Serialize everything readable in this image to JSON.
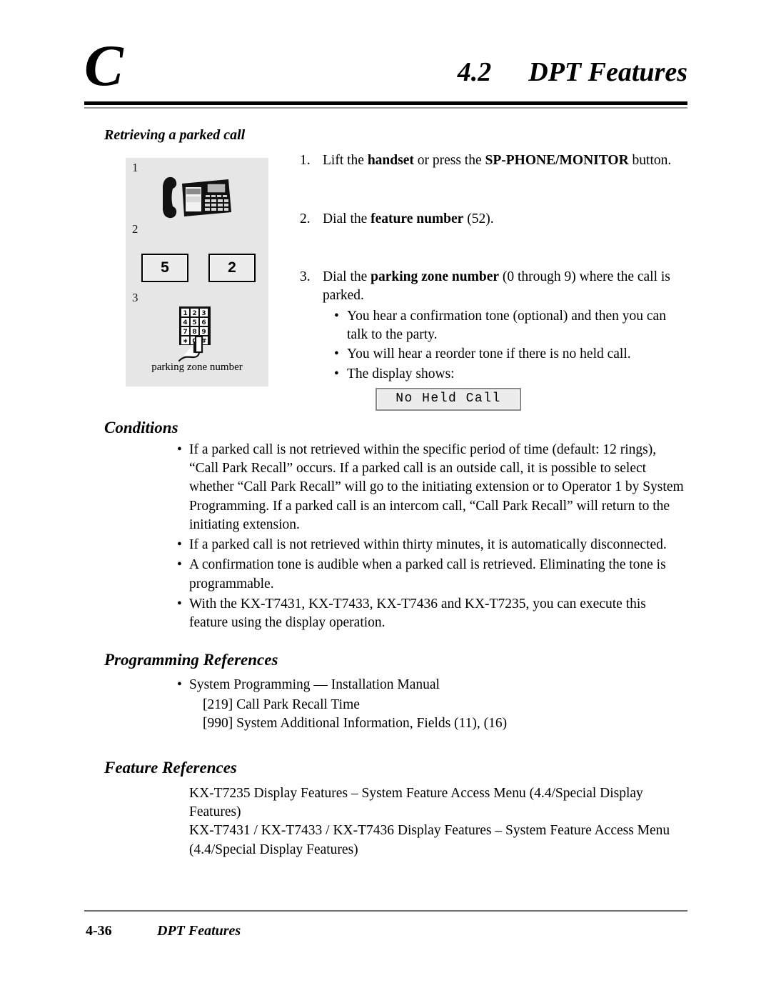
{
  "header": {
    "chapter_letter": "C",
    "section_number": "4.2",
    "section_title": "DPT Features"
  },
  "subsection": {
    "title": "Retrieving a parked call"
  },
  "illustration": {
    "step_labels": [
      "1",
      "2",
      "3"
    ],
    "phone_icon": "desk-phone-handset-lifted-icon",
    "key_boxes": [
      "5",
      "2"
    ],
    "keypad": {
      "rows": [
        [
          "1",
          "2",
          "3"
        ],
        [
          "4",
          "5",
          "6"
        ],
        [
          "7",
          "8",
          "9"
        ],
        [
          "∗",
          "0",
          "#"
        ]
      ],
      "hand_icon": "hand-pressing-key-icon"
    },
    "caption": "parking zone number",
    "background_color": "#e6e6e6"
  },
  "steps": [
    {
      "number": "1.",
      "parts": [
        {
          "text": "Lift the ",
          "bold": false
        },
        {
          "text": "handset",
          "bold": true
        },
        {
          "text": " or press the ",
          "bold": false
        },
        {
          "text": "SP-PHONE/MONITOR",
          "bold": true
        },
        {
          "text": " button.",
          "bold": false
        }
      ]
    },
    {
      "number": "2.",
      "parts": [
        {
          "text": "Dial the ",
          "bold": false
        },
        {
          "text": "feature number",
          "bold": true
        },
        {
          "text": " (52).",
          "bold": false
        }
      ]
    },
    {
      "number": "3.",
      "parts": [
        {
          "text": "Dial the ",
          "bold": false
        },
        {
          "text": "parking zone number",
          "bold": true
        },
        {
          "text": " (0 through 9) where the call is parked.",
          "bold": false
        }
      ],
      "substeps": [
        "You hear a confirmation tone (optional) and then you can talk to the party.",
        "You will hear a reorder tone if there is no held call.",
        "The display shows:"
      ],
      "display_text": "No Held Call"
    }
  ],
  "conditions": {
    "heading": "Conditions",
    "items": [
      "If a parked call is not retrieved within the specific period of time (default: 12 rings), “Call Park Recall” occurs.  If a parked call is an outside call, it is possible to select whether “Call Park Recall” will go to the initiating extension or to Operator 1 by System Programming.  If a parked call is an intercom call, “Call Park Recall” will return to the initiating extension.",
      "If a parked call is not retrieved within thirty minutes, it is automatically disconnected.",
      "A confirmation tone is audible when a parked call is retrieved.  Eliminating the tone is programmable.",
      "With the KX-T7431, KX-T7433, KX-T7436 and KX-T7235, you can execute this feature using the display operation."
    ]
  },
  "programming_references": {
    "heading": "Programming References",
    "bullet": "System Programming — Installation Manual",
    "entries": [
      "[219]  Call Park Recall Time",
      "[990]  System Additional Information, Fields (11), (16)"
    ]
  },
  "feature_references": {
    "heading": "Feature References",
    "entries": [
      "KX-T7235 Display Features – System Feature Access Menu (4.4/Special Display Features)",
      "KX-T7431 / KX-T7433 / KX-T7436 Display Features – System Feature Access Menu (4.4/Special Display Features)"
    ]
  },
  "footer": {
    "page_number": "4-36",
    "title": "DPT Features"
  }
}
